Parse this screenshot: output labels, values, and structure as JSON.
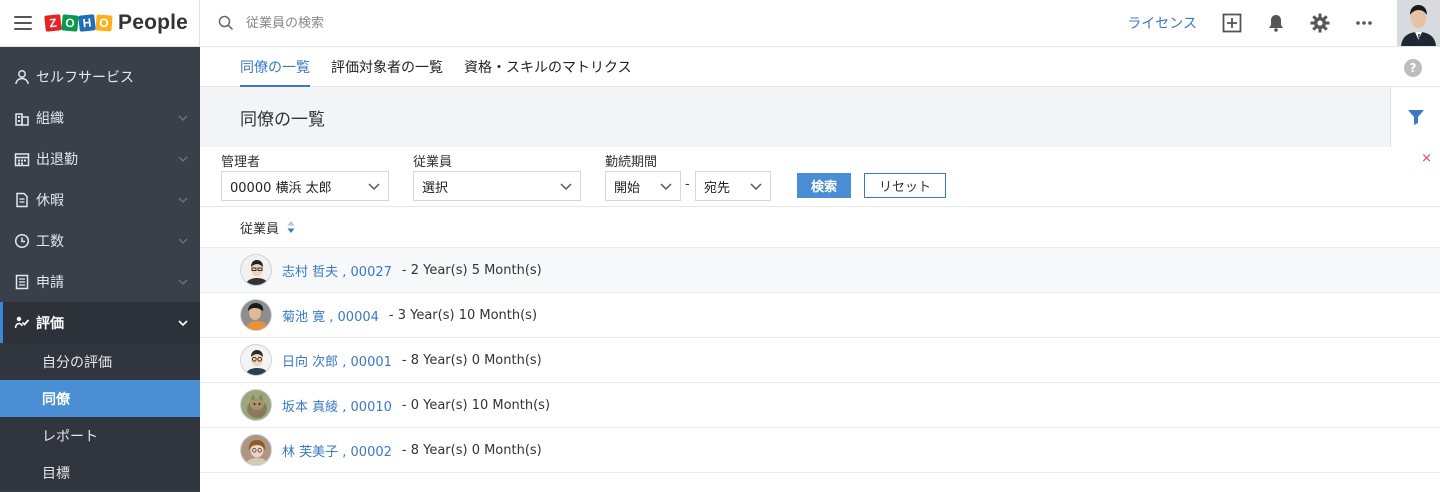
{
  "brand": {
    "zoho_letters": [
      "Z",
      "O",
      "H",
      "O"
    ],
    "zoho_colors": [
      "#e42527",
      "#089949",
      "#226db4",
      "#f9b21d"
    ],
    "product": "People"
  },
  "search": {
    "placeholder": "従業員の検索"
  },
  "topbar": {
    "license_label": "ライセンス"
  },
  "sidebar": {
    "items": [
      {
        "label": "セルフサービス",
        "icon": "user-icon"
      },
      {
        "label": "組織",
        "icon": "building-icon"
      },
      {
        "label": "出退勤",
        "icon": "calendar-icon"
      },
      {
        "label": "休暇",
        "icon": "leave-icon"
      },
      {
        "label": "工数",
        "icon": "clock-icon"
      },
      {
        "label": "申請",
        "icon": "document-icon"
      },
      {
        "label": "評価",
        "icon": "performance-icon"
      }
    ],
    "sub_items": [
      "自分の評価",
      "同僚",
      "レポート",
      "目標"
    ]
  },
  "tabs": [
    "同僚の一覧",
    "評価対象者の一覧",
    "資格・スキルのマトリクス"
  ],
  "page": {
    "title": "同僚の一覧"
  },
  "filters": {
    "manager_label": "管理者",
    "manager_value": "00000 横浜 太郎",
    "employee_label": "従業員",
    "employee_value": "選択",
    "period_label": "勤続期間",
    "period_start": "開始",
    "period_dash": "-",
    "period_end": "宛先",
    "search_button": "検索",
    "reset_button": "リセット",
    "close": "×"
  },
  "table": {
    "column_header": "従業員",
    "rows": [
      {
        "name": "志村 哲夫 , 00027",
        "duration": "- 2 Year(s) 5 Month(s)"
      },
      {
        "name": "菊池 寛 , 00004",
        "duration": "- 3 Year(s) 10 Month(s)"
      },
      {
        "name": "日向 次郎 , 00001",
        "duration": "- 8 Year(s) 0 Month(s)"
      },
      {
        "name": "坂本 真綾 , 00010",
        "duration": "- 0 Year(s) 10 Month(s)"
      },
      {
        "name": "林 芙美子 , 00002",
        "duration": "- 8 Year(s) 0 Month(s)"
      }
    ]
  },
  "colors": {
    "accent": "#3b78c5",
    "sidebar_bg": "#3a4049",
    "selected_bg": "#4a8ed4",
    "close_red": "#e04848"
  }
}
